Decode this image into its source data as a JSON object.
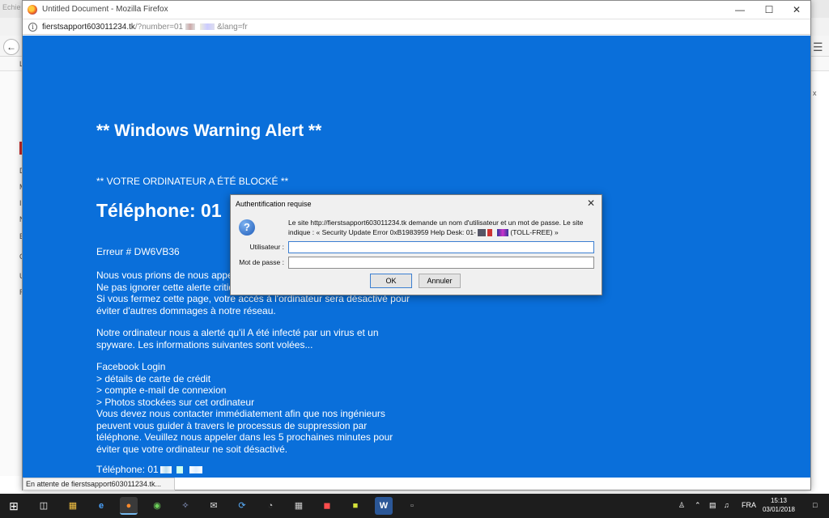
{
  "background_browser": {
    "title_fragment": "Echie",
    "sidebar_letters": [
      "L",
      "D",
      "M",
      "I",
      "N",
      "E",
      "C",
      "U",
      "R"
    ],
    "right_cut": "x"
  },
  "popup": {
    "window_title": "Untitled Document - Mozilla Firefox",
    "url_host": "fierstsapport603011234.tk",
    "url_path": "/?number=01",
    "url_suffix": "&lang=fr",
    "status_text": "En attente de fierstsapport603011234.tk..."
  },
  "scam_page": {
    "heading": "** Windows Warning Alert **",
    "blocked_line": "** VOTRE ORDINATEUR A ÉTÉ BLOCKÉ **",
    "phone_big": "Téléphone: 01",
    "error_line": "Erreur # DW6VB36",
    "paragraph1": [
      "Nous vous prions de nous appeler",
      "Ne pas ignorer cette alerte critique",
      "Si vous fermez cette page, votre accès à l'ordinateur sera désactivé pour",
      "éviter d'autres dommages à notre réseau."
    ],
    "paragraph2": [
      "Notre ordinateur nous a alerté qu'il A été infecté par un virus et un",
      "spyware. Les informations suivantes sont volées..."
    ],
    "paragraph3": [
      "Facebook Login",
      "> détails de carte de crédit",
      "> compte e-mail de connexion",
      "> Photos stockées sur cet ordinateur",
      "Vous devez nous contacter immédiatement afin que nos ingénieurs",
      "peuvent vous guider à travers le processus de suppression par",
      "téléphone. Veuillez nous appeler dans les 5 prochaines minutes pour",
      "éviter que votre ordinateur ne soit désactivé."
    ],
    "phone_bottom": "Téléphone: 01"
  },
  "dialog": {
    "title": "Authentification requise",
    "message": "Le site http://fierstsapport603011234.tk demande un nom d'utilisateur et un mot de passe. Le site indique : « Security Update Error 0xB1983959 Help Desk: 01-",
    "message_tail": "(TOLL-FREE) »",
    "username_label": "Utilisateur :",
    "password_label": "Mot de passe :",
    "username_value": "",
    "password_value": "",
    "ok_label": "OK",
    "cancel_label": "Annuler"
  },
  "taskbar": {
    "apps": [
      "start-icon",
      "task-view-icon",
      "file-explorer-icon",
      "edge-icon",
      "firefox-icon",
      "chrome-icon",
      "tool-icon",
      "mail-icon",
      "sync-icon",
      "media-icon",
      "calculator-icon",
      "shield-app-icon",
      "app-icon",
      "word-icon",
      "document-icon"
    ],
    "language": "FRA",
    "time": "15:13",
    "date": "03/01/2018"
  },
  "colors": {
    "scam_blue": "#0a6fda",
    "taskbar": "#1d1d1d",
    "dialog_bg": "#f0f0f0"
  }
}
